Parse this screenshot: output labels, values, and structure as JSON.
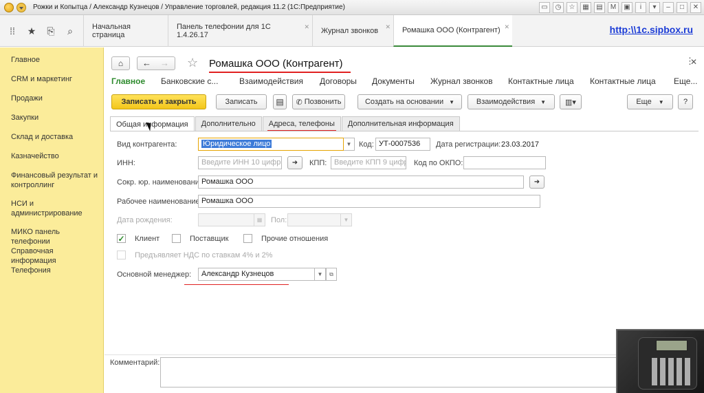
{
  "window": {
    "title": "Рожки и Копытца / Александр Кузнецов / Управление торговлей, редакция 11.2  (1С:Предприятие)"
  },
  "topbar": {
    "tabs": [
      {
        "label": "Начальная страница"
      },
      {
        "label": "Панель телефонии для 1С 1.4.26.17"
      },
      {
        "label": "Журнал звонков"
      },
      {
        "label": "Ромашка ООО (Контрагент)"
      }
    ],
    "site_link": "http:\\\\1c.sipbox.ru"
  },
  "sidebar": {
    "items": [
      {
        "label": "Главное"
      },
      {
        "label": "CRM и маркетинг"
      },
      {
        "label": "Продажи"
      },
      {
        "label": "Закупки"
      },
      {
        "label": "Склад и доставка"
      },
      {
        "label": "Казначейство"
      },
      {
        "label": "Финансовый результат и контроллинг"
      },
      {
        "label": "НСИ и администрирование"
      },
      {
        "label": "МИКО панель телефонии"
      },
      {
        "label": "Справочная информация"
      },
      {
        "label": "Телефония"
      }
    ]
  },
  "form": {
    "title": "Ромашка ООО (Контрагент)",
    "links": [
      "Главное",
      "Банковские с...",
      "Взаимодействия",
      "Договоры",
      "Документы",
      "Журнал звонков",
      "Контактные лица",
      "Контактные лица",
      "Еще..."
    ],
    "buttons": {
      "save_close": "Записать и закрыть",
      "save": "Записать",
      "call": "Позвонить",
      "create_based": "Создать на основании",
      "interactions": "Взаимодействия",
      "more": "Еще",
      "help": "?"
    },
    "tabs": [
      "Общая информация",
      "Дополнительно",
      "Адреса, телефоны",
      "Дополнительная информация"
    ],
    "fields": {
      "kind_label": "Вид контрагента:",
      "kind_value": "Юридическое лицо",
      "code_label": "Код:",
      "code_value": "УТ-0007536",
      "reg_label": "Дата регистрации:",
      "reg_value": "23.03.2017",
      "inn_label": "ИНН:",
      "inn_placeholder": "Введите ИНН 10 цифр",
      "kpp_label": "КПП:",
      "kpp_placeholder": "Введите КПП 9 цифр",
      "okpo_label": "Код по ОКПО:",
      "short_name_label": "Сокр. юр. наименование:",
      "short_name_value": "Ромашка ООО",
      "work_name_label": "Рабочее наименование:",
      "work_name_value": "Ромашка ООО",
      "birth_label": "Дата рождения:",
      "sex_label": "Пол:",
      "client_label": "Клиент",
      "client_checked": true,
      "supplier_label": "Поставщик",
      "other_label": "Прочие отношения",
      "vat_label": "Предъявляет НДС по ставкам 4% и 2%",
      "manager_label": "Основной менеджер:",
      "manager_value": "Александр Кузнецов",
      "comment_label": "Комментарий:"
    }
  },
  "colors": {
    "sidebar_bg": "#fbec9a",
    "primary_button": "#f3c61a",
    "active_link": "#2e8b2e",
    "underline": "#e02020",
    "site_link": "#1a3bd6"
  }
}
